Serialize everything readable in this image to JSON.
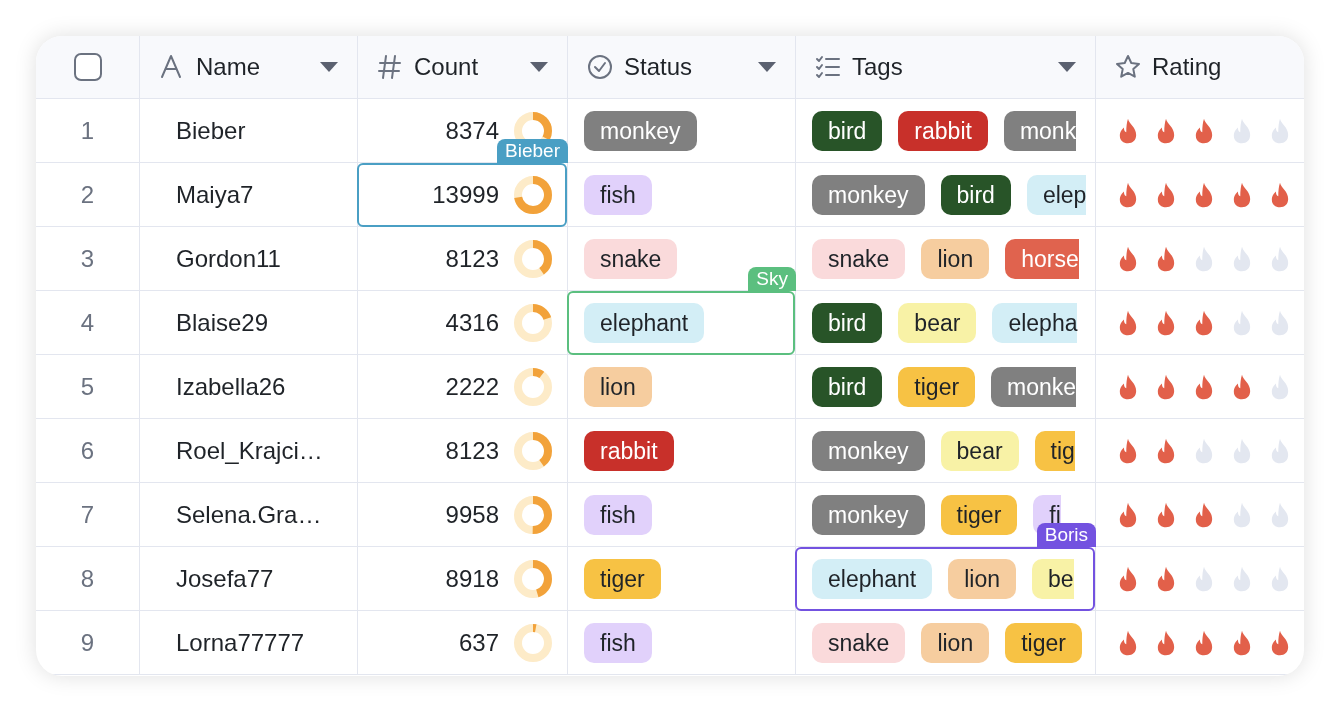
{
  "header": {
    "select_all": {
      "checked": false
    },
    "columns": [
      {
        "label": "Name",
        "kind": "text",
        "menu": true
      },
      {
        "label": "Count",
        "kind": "number",
        "menu": true
      },
      {
        "label": "Status",
        "kind": "status",
        "menu": true
      },
      {
        "label": "Tags",
        "kind": "list",
        "menu": true
      },
      {
        "label": "Rating",
        "kind": "star",
        "menu": false
      }
    ]
  },
  "rows": [
    {
      "number": "1",
      "name": "Bieber",
      "count": "8374",
      "level": 0.33,
      "status": {
        "label": "monkey",
        "color": "#808080"
      },
      "tags": [
        {
          "label": "bird",
          "color": "#285428",
          "cut": false
        },
        {
          "label": "rabbit",
          "color": "#c8302a",
          "cut": false
        },
        {
          "label": "monk",
          "color": "#808080",
          "cut": true
        }
      ],
      "stars": 3
    },
    {
      "number": "2",
      "name": "Maiya7",
      "count": "13999",
      "level": 0.72,
      "status": {
        "label": "fish",
        "color": "#e1d1fb"
      },
      "tags": [
        {
          "label": "monkey",
          "color": "#808080",
          "cut": false
        },
        {
          "label": "bird",
          "color": "#285428",
          "cut": false
        },
        {
          "label": "elep",
          "color": "#d3eef6",
          "cut": true
        }
      ],
      "stars": 5,
      "count_collaborator": {
        "name": "Bieber",
        "color": "#4a9fc4"
      }
    },
    {
      "number": "3",
      "name": "Gordon11",
      "count": "8123",
      "level": 0.4,
      "status": {
        "label": "snake",
        "color": "#fadadb"
      },
      "tags": [
        {
          "label": "snake",
          "color": "#fadadb",
          "cut": false
        },
        {
          "label": "lion",
          "color": "#f6cd9f",
          "cut": false
        },
        {
          "label": "horse",
          "color": "#e0634e",
          "cut": true
        }
      ],
      "stars": 2
    },
    {
      "number": "4",
      "name": "Blaise29",
      "count": "4316",
      "level": 0.2,
      "status": {
        "label": "elephant",
        "color": "#d3eef6"
      },
      "tags": [
        {
          "label": "bird",
          "color": "#285428",
          "cut": false
        },
        {
          "label": "bear",
          "color": "#f8f2a6",
          "cut": false
        },
        {
          "label": "elepha",
          "color": "#d3eef6",
          "cut": true
        }
      ],
      "stars": 3,
      "status_collaborator": {
        "name": "Sky",
        "color": "#5bbf7f"
      }
    },
    {
      "number": "5",
      "name": "Izabella26",
      "count": "2222",
      "level": 0.1,
      "status": {
        "label": "lion",
        "color": "#f6cd9f"
      },
      "tags": [
        {
          "label": "bird",
          "color": "#285428",
          "cut": false
        },
        {
          "label": "tiger",
          "color": "#f7c244",
          "cut": false
        },
        {
          "label": "monke",
          "color": "#808080",
          "cut": true
        }
      ],
      "stars": 4
    },
    {
      "number": "6",
      "name": "Roel_Krajci…",
      "count": "8123",
      "level": 0.4,
      "status": {
        "label": "rabbit",
        "color": "#c8302a"
      },
      "tags": [
        {
          "label": "monkey",
          "color": "#808080",
          "cut": false
        },
        {
          "label": "bear",
          "color": "#f8f2a6",
          "cut": false
        },
        {
          "label": "tig",
          "color": "#f7c244",
          "cut": true
        }
      ],
      "stars": 2
    },
    {
      "number": "7",
      "name": "Selena.Gra…",
      "count": "9958",
      "level": 0.5,
      "status": {
        "label": "fish",
        "color": "#e1d1fb"
      },
      "tags": [
        {
          "label": "monkey",
          "color": "#808080",
          "cut": false
        },
        {
          "label": "tiger",
          "color": "#f7c244",
          "cut": false
        },
        {
          "label": "fi",
          "color": "#e1d1fb",
          "cut": true
        }
      ],
      "stars": 3
    },
    {
      "number": "8",
      "name": "Josefa77",
      "count": "8918",
      "level": 0.45,
      "status": {
        "label": "tiger",
        "color": "#f7c244"
      },
      "tags": [
        {
          "label": "elephant",
          "color": "#d3eef6",
          "cut": false
        },
        {
          "label": "lion",
          "color": "#f6cd9f",
          "cut": false
        },
        {
          "label": "be",
          "color": "#f8f2a6",
          "cut": true
        }
      ],
      "stars": 2,
      "tags_collaborator": {
        "name": "Boris",
        "color": "#7352e0"
      }
    },
    {
      "number": "9",
      "name": "Lorna77777",
      "count": "637",
      "level": 0.03,
      "status": {
        "label": "fish",
        "color": "#e1d1fb"
      },
      "tags": [
        {
          "label": "snake",
          "color": "#fadadb",
          "cut": false
        },
        {
          "label": "lion",
          "color": "#f6cd9f",
          "cut": false
        },
        {
          "label": "tiger",
          "color": "#f7c244",
          "cut": false
        }
      ],
      "stars": 5
    }
  ]
}
